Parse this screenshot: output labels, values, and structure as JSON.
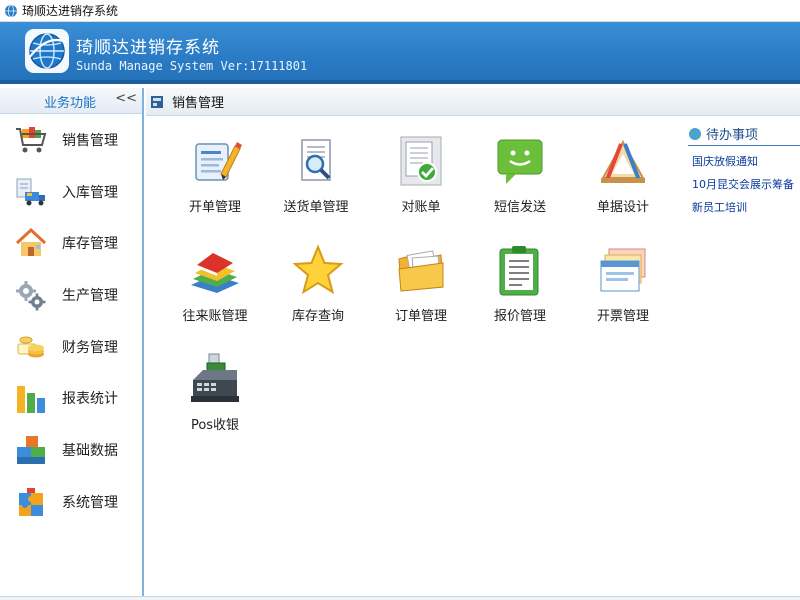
{
  "window": {
    "title": "琦顺达进销存系统"
  },
  "banner": {
    "app_title": "琦顺达进销存系统",
    "app_subtitle": "Sunda Manage System Ver:17111801"
  },
  "sidebar": {
    "title": "业务功能",
    "collapse_glyph": "<<",
    "items": [
      {
        "label": "销售管理",
        "icon": "shopping-cart-icon"
      },
      {
        "label": "入库管理",
        "icon": "delivery-truck-icon"
      },
      {
        "label": "库存管理",
        "icon": "house-icon"
      },
      {
        "label": "生产管理",
        "icon": "gears-icon"
      },
      {
        "label": "财务管理",
        "icon": "coins-icon"
      },
      {
        "label": "报表统计",
        "icon": "bar-chart-icon"
      },
      {
        "label": "基础数据",
        "icon": "blocks-icon"
      },
      {
        "label": "系统管理",
        "icon": "system-puzzle-icon"
      }
    ]
  },
  "main": {
    "title": "销售管理",
    "grid": [
      {
        "label": "开单管理",
        "icon": "order-form-pen-icon"
      },
      {
        "label": "送货单管理",
        "icon": "magnifier-document-icon"
      },
      {
        "label": "对账单",
        "icon": "checked-document-icon"
      },
      {
        "label": "短信发送",
        "icon": "sms-bubble-icon"
      },
      {
        "label": "单据设计",
        "icon": "drafting-tools-icon"
      },
      {
        "label": "往来账管理",
        "icon": "books-stack-icon"
      },
      {
        "label": "库存查询",
        "icon": "star-icon"
      },
      {
        "label": "订单管理",
        "icon": "folder-documents-icon"
      },
      {
        "label": "报价管理",
        "icon": "clipboard-list-icon"
      },
      {
        "label": "开票管理",
        "icon": "windows-stack-icon"
      },
      {
        "label": "Pos收银",
        "icon": "cash-register-icon"
      }
    ]
  },
  "todo": {
    "title": "待办事项",
    "items": [
      "国庆放假通知",
      "10月昆交会展示筹备",
      "新员工培训"
    ]
  },
  "colors": {
    "banner_blue": "#2b7cc6",
    "sidebar_title_blue": "#1b73c4",
    "todo_link_blue": "#0a3a9a"
  }
}
